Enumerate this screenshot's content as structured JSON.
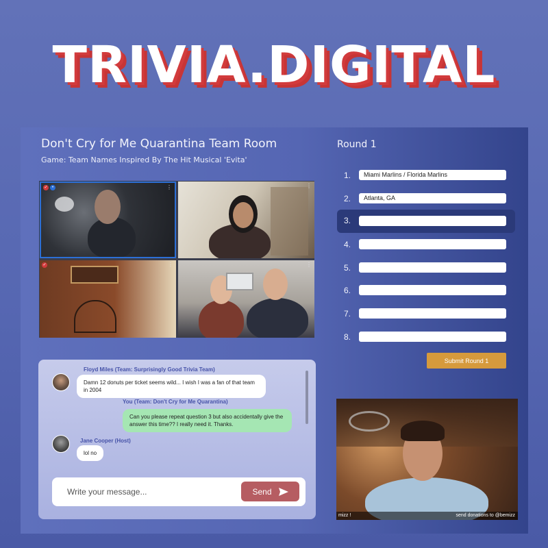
{
  "logo": {
    "text": "TRIVIA.DIGITAL"
  },
  "room": {
    "title": "Don't Cry for Me Quarantina Team Room",
    "subtitle": "Game: Team Names Inspired By The Hit Musical 'Evita'"
  },
  "video_grid": {
    "tiles": [
      {
        "name": "participant-1",
        "badges": [
          "red",
          "blue"
        ],
        "menu": "⋮"
      },
      {
        "name": "participant-2",
        "badges": [],
        "menu": "⋮"
      },
      {
        "name": "participant-3",
        "badges": [
          "red"
        ],
        "menu": "⋮"
      },
      {
        "name": "participant-4",
        "badges": [],
        "menu": "⋮"
      }
    ]
  },
  "chat": {
    "messages": [
      {
        "author": "Floyd Miles (Team: Surprisingly Good Trivia Team)",
        "text": "Damn 12 donuts per ticket seems wild... I wish I was a fan of that team in 2004"
      },
      {
        "author": "You (Team: Don't Cry for Me Quarantina)",
        "text": "Can you please repeat question 3 but also accidentally give the answer this time?? I really need it. Thanks."
      },
      {
        "author": "Jane Cooper (Host)",
        "text": "lol no"
      }
    ],
    "input_placeholder": "Write your message...",
    "send_label": "Send"
  },
  "round": {
    "title": "Round 1",
    "answers": [
      {
        "number": "1.",
        "value": "Miami Marlins / Florida Marlins"
      },
      {
        "number": "2.",
        "value": "Atlanta, GA"
      },
      {
        "number": "3.",
        "value": ""
      },
      {
        "number": "4.",
        "value": ""
      },
      {
        "number": "5.",
        "value": ""
      },
      {
        "number": "6.",
        "value": ""
      },
      {
        "number": "7.",
        "value": ""
      },
      {
        "number": "8.",
        "value": ""
      }
    ],
    "active_answer": 3,
    "submit_label": "Submit Round 1"
  },
  "stream": {
    "left_label": "mizz !",
    "right_label": "send donations to @bemizz"
  },
  "colors": {
    "accent_red": "#d23b3c",
    "send_button": "#b65d62",
    "submit_button": "#d69a3c",
    "active_row": "#2b3a79",
    "my_bubble": "#a5e6b3"
  }
}
